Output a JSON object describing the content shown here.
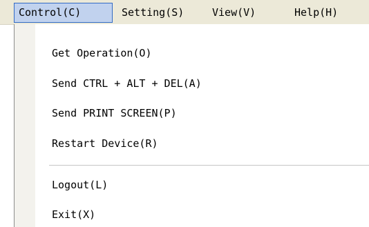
{
  "menubar": {
    "control": "Control(C)",
    "setting": "Setting(S)",
    "view": "View(V)",
    "help": "Help(H)"
  },
  "dropdown": {
    "items": [
      {
        "label": "Get Operation(O)"
      },
      {
        "label": "Send CTRL + ALT + DEL(A)"
      },
      {
        "label": "Send PRINT SCREEN(P)"
      },
      {
        "label": "Restart Device(R)"
      },
      {
        "label": "Logout(L)"
      },
      {
        "label": "Exit(X)"
      }
    ]
  },
  "colors": {
    "menubar_bg": "#ece9d8",
    "active_bg": "#c1d2ee",
    "active_border": "#316ac5",
    "gutter_bg": "#f3f2ed"
  }
}
